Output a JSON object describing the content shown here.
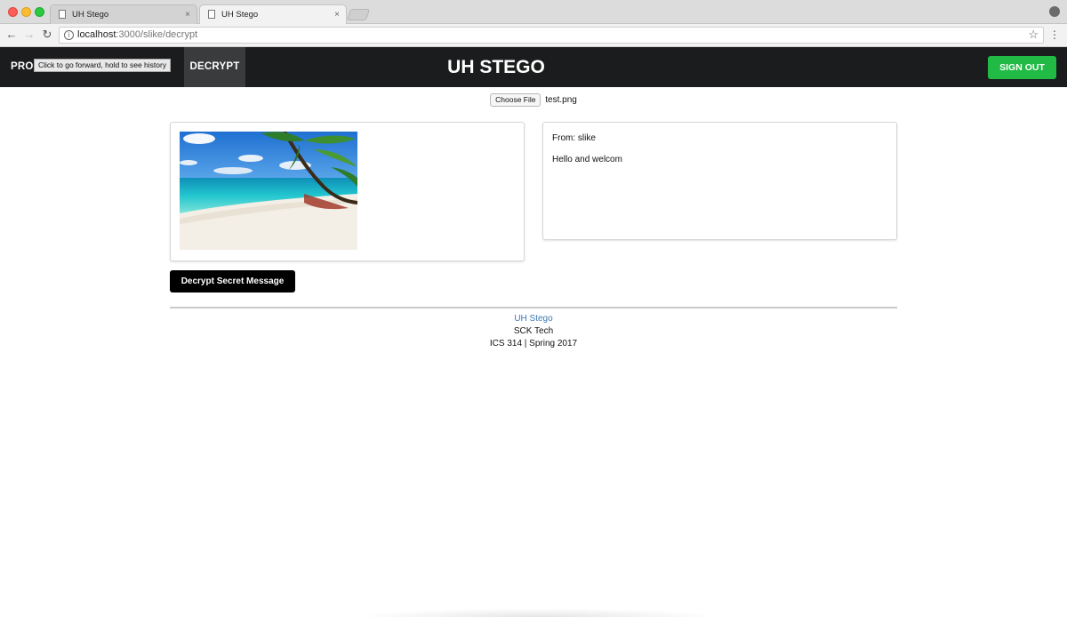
{
  "browser": {
    "tabs": [
      {
        "title": "UH Stego",
        "active": false
      },
      {
        "title": "UH Stego",
        "active": true
      }
    ],
    "tab_close_glyph": "×",
    "url_host": "localhost",
    "url_path": ":3000/slike/decrypt",
    "tooltip": "Click to go forward, hold to see history"
  },
  "navbar": {
    "profile_label": "PROFILE",
    "decrypt_label": "DECRYPT",
    "brand": "UH STEGO",
    "signout_label": "SIGN OUT"
  },
  "file_input": {
    "button_label": "Choose File",
    "file_name": "test.png"
  },
  "message": {
    "from": "From: slike",
    "body": "Hello and welcom"
  },
  "decrypt_button_label": "Decrypt Secret Message",
  "footer": {
    "link": "UH Stego",
    "org": "SCK Tech",
    "course": "ICS 314 | Spring 2017"
  },
  "colors": {
    "navbar_bg": "#1b1c1d",
    "signout_green": "#21ba45",
    "footer_link": "#3d7ab5"
  }
}
